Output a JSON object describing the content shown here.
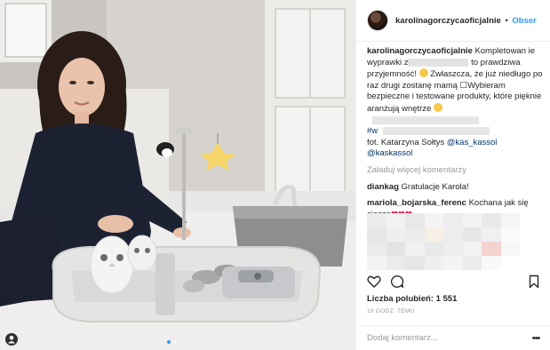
{
  "post": {
    "username": "karolinagorczycaoficjalnie",
    "separator": "•",
    "follow_label": "Obser"
  },
  "caption": {
    "username": "karolinagorczycaoficjalnie",
    "text_1": "Kompletowan ie wyprawki z",
    "text_2": " to prawdziwa przyjemność! ",
    "text_3": " Zwłaszcza, że już niedługo po raz drugi zostanę mamą ☐Wybieram bezpieczne i testowane produkty, które pięknie aranżują wnętrze ",
    "hashtag": "#w",
    "credit_prefix": "fot. Katarzyna Sołtys ",
    "credit_mention_1": "@kas_kassol",
    "credit_mention_2": "@kaskassol"
  },
  "load_more_label": "Załaduj więcej komentarzy",
  "comments": [
    {
      "username": "diankag",
      "text": "Gratulacje Karola!"
    },
    {
      "username": "mariola_bojarska_ferenc",
      "text": "Kochana jak się cieszę",
      "emoji": "❤❤❤"
    }
  ],
  "likes_text": "Liczba polubień: 1 551",
  "time_text": "19 GODZ. TEMU",
  "comment_placeholder": "Dodaj komentarz...",
  "more_label": "•••",
  "icons": [
    "tag-person-icon",
    "heart-icon",
    "comment-icon",
    "bookmark-icon",
    "more-options-icon"
  ],
  "colors": {
    "accent": "#3897f0",
    "text": "#262626",
    "muted": "#999999",
    "border": "#efefef"
  }
}
